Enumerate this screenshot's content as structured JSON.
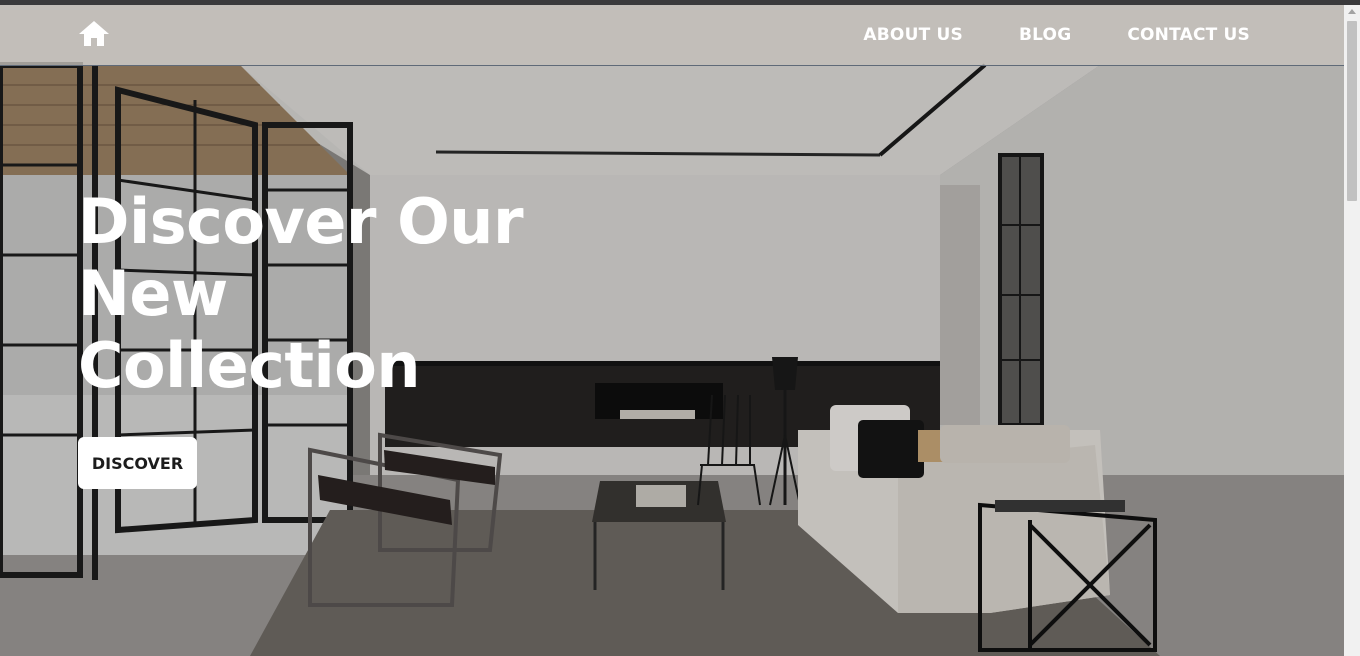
{
  "header": {
    "home_icon": "home-icon",
    "nav": [
      {
        "label": "ABOUT US"
      },
      {
        "label": "BLOG"
      },
      {
        "label": "CONTACT US"
      }
    ]
  },
  "hero": {
    "title_lines": [
      "Discover Our",
      "New",
      "Collection"
    ],
    "button_label": "DISCOVER",
    "background": "living-room-photo"
  },
  "colors": {
    "header_bg": "#c4c0ba",
    "header_text": "#ffffff",
    "button_bg": "#ffffff",
    "button_text": "#1c1c1c"
  }
}
